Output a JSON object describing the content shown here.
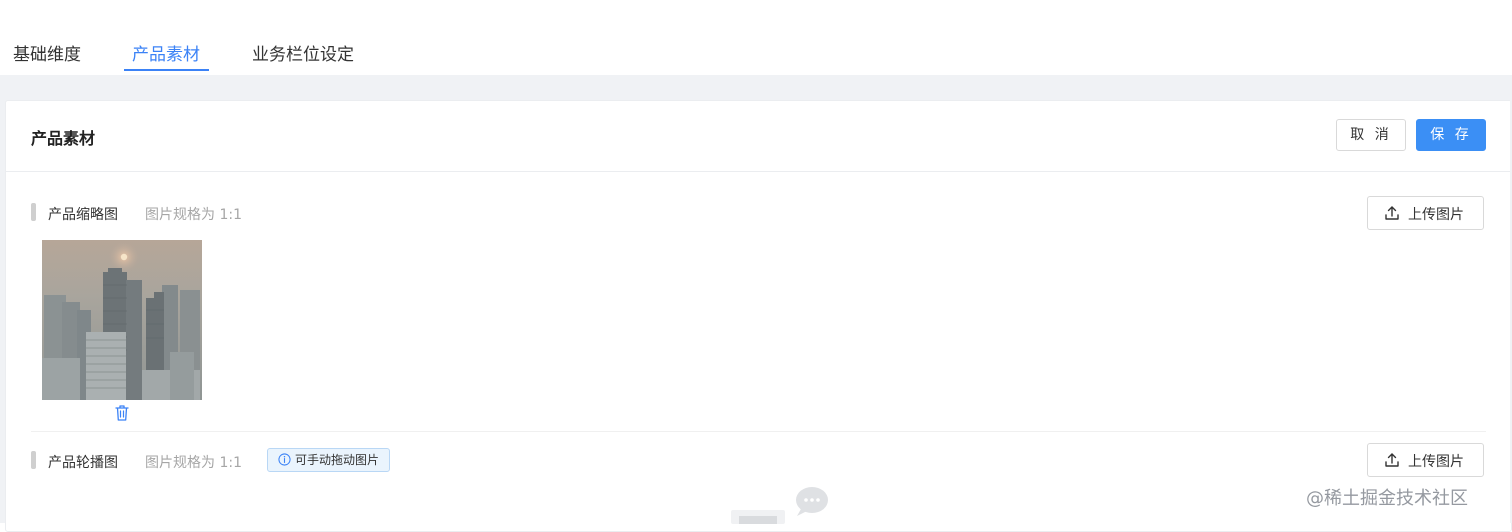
{
  "tabs": [
    {
      "label": "基础维度",
      "active": false
    },
    {
      "label": "产品素材",
      "active": true
    },
    {
      "label": "业务栏位设定",
      "active": false
    }
  ],
  "accent_color": "#3b82f6",
  "card": {
    "title": "产品素材",
    "cancel_label": "取 消",
    "save_label": "保 存"
  },
  "sections": {
    "thumbnail": {
      "title": "产品缩略图",
      "hint": "图片规格为 1:1",
      "upload_label": "上传图片",
      "image_icon": "city-skyline-photo",
      "delete_icon": "trash-icon"
    },
    "carousel": {
      "title": "产品轮播图",
      "hint": "图片规格为 1:1",
      "tag": "可手动拖动图片",
      "upload_label": "上传图片"
    }
  },
  "watermark": "@稀土掘金技术社区"
}
